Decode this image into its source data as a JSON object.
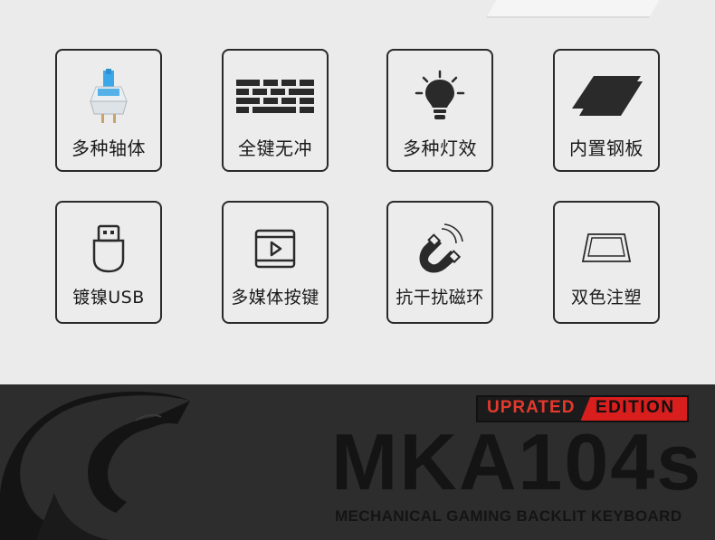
{
  "features": [
    {
      "label": "多种轴体",
      "icon": "key-switch-icon"
    },
    {
      "label": "全键无冲",
      "icon": "brick-wall-icon"
    },
    {
      "label": "多种灯效",
      "icon": "light-bulb-icon"
    },
    {
      "label": "内置钢板",
      "icon": "steel-plate-icon"
    },
    {
      "label": "镀镍USB",
      "icon": "usb-plug-icon"
    },
    {
      "label": "多媒体按键",
      "icon": "media-play-icon"
    },
    {
      "label": "抗干扰磁环",
      "icon": "magnet-icon"
    },
    {
      "label": "双色注塑",
      "icon": "keycap-icon"
    }
  ],
  "banner": {
    "badge_left": "UPRATED",
    "badge_right": "EDITION",
    "model": "MKA104s",
    "subtitle": "MECHANICAL GAMING BACKLIT KEYBOARD"
  },
  "colors": {
    "accent": "#d91e1e",
    "banner_bg": "#2d2d2d",
    "page_bg": "#ebebeb",
    "switch_blue": "#3aa7e8"
  }
}
